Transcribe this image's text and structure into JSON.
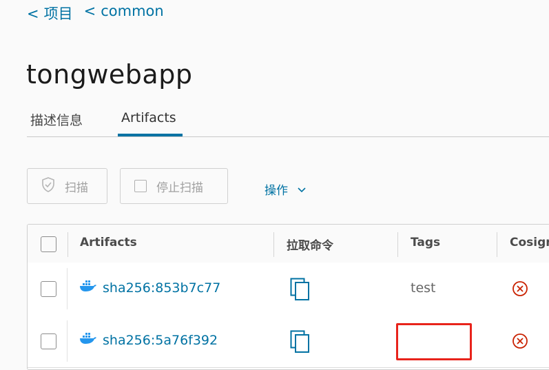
{
  "breadcrumb": {
    "items": [
      "项目",
      "common"
    ],
    "separator": "<"
  },
  "page": {
    "title": "tongwebapp"
  },
  "tabs": [
    {
      "label": "描述信息",
      "active": false
    },
    {
      "label": "Artifacts",
      "active": true
    }
  ],
  "toolbar": {
    "scan_label": "扫描",
    "stop_scan_label": "停止扫描",
    "actions_label": "操作"
  },
  "table": {
    "columns": [
      "Artifacts",
      "拉取命令",
      "Tags",
      "Cosign"
    ],
    "rows": [
      {
        "digest": "sha256:853b7c77",
        "tag": "test",
        "cosign": "unsigned",
        "icons": [
          "docker-icon",
          "copy-icon",
          "close-circle-icon"
        ]
      },
      {
        "digest": "sha256:5a76f392",
        "tag": "",
        "cosign": "unsigned",
        "icons": [
          "docker-icon",
          "copy-icon",
          "close-circle-icon"
        ]
      }
    ]
  },
  "colors": {
    "accent": "#0072a3",
    "error": "#c92100",
    "highlight_box": "#e8231b",
    "docker": "#2496ed"
  }
}
